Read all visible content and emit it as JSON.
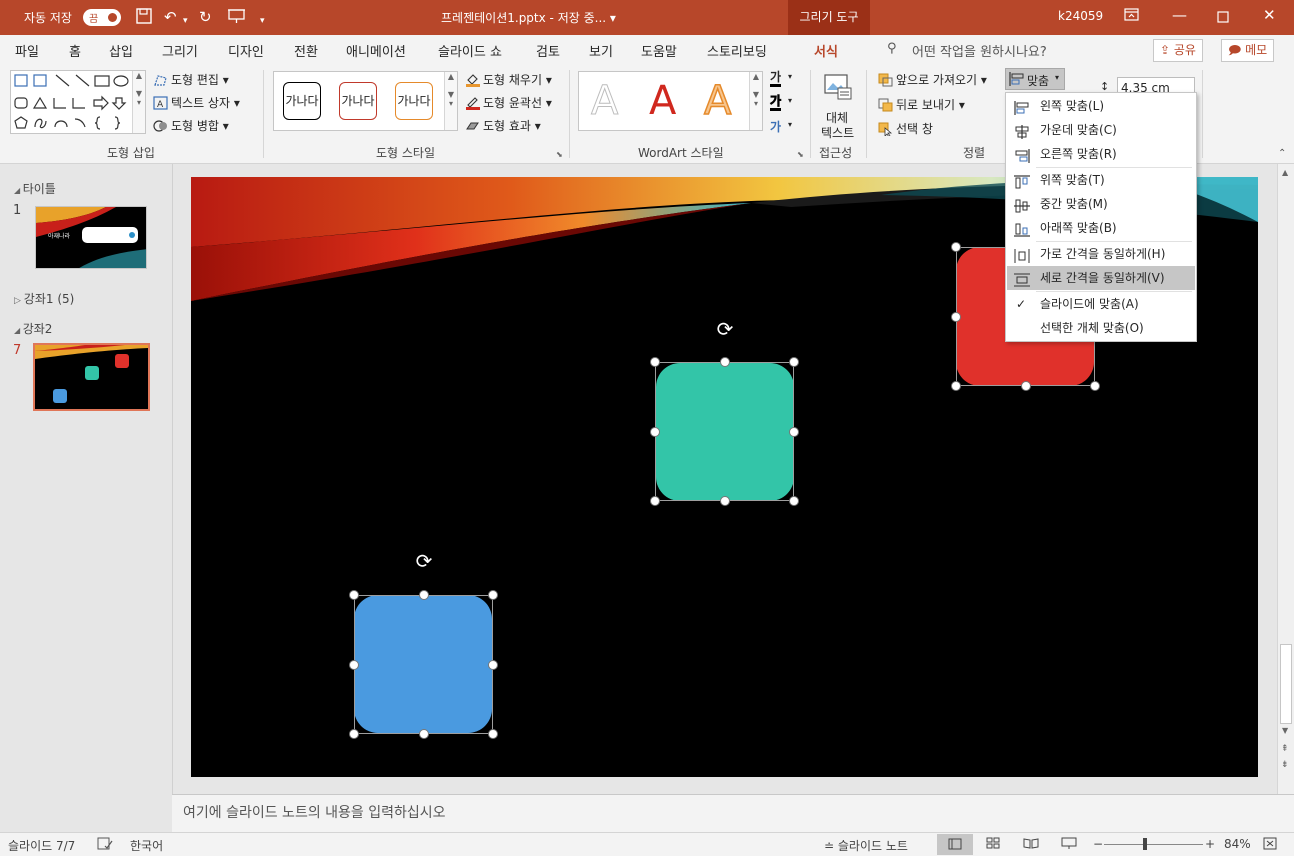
{
  "titlebar": {
    "autosave_label": "자동 저장",
    "autosave_state": "끔",
    "doc_title": "프레젠테이션1.pptx - 저장 중... ▾",
    "context_tab": "그리기 도구",
    "user": "k24059"
  },
  "tabs": [
    "파일",
    "홈",
    "삽입",
    "그리기",
    "디자인",
    "전환",
    "애니메이션",
    "슬라이드 쇼",
    "검토",
    "보기",
    "도움말",
    "스토리보딩",
    "서식"
  ],
  "tell_me": "어떤 작업을 원하시나요?",
  "share_label": "공유",
  "comments_label": "메모",
  "ribbon": {
    "insert_shapes": {
      "edit_shape": "도형 편집",
      "text_box": "텍스트 상자",
      "merge_shapes": "도형 병합",
      "label": "도형 삽입"
    },
    "shape_styles": {
      "preset_text": "가나다",
      "fill": "도형 채우기",
      "outline": "도형 윤곽선",
      "effects": "도형 효과",
      "label": "도형 스타일"
    },
    "wordart": {
      "glyph": "A",
      "text_glyph": "가",
      "label": "WordArt 스타일"
    },
    "accessibility": {
      "alt_text_1": "대체",
      "alt_text_2": "텍스트",
      "label": "접근성"
    },
    "arrange": {
      "bring_forward": "앞으로 가져오기",
      "send_backward": "뒤로 보내기",
      "selection_pane": "선택 창",
      "align": "맞춤",
      "label": "정렬"
    },
    "size": {
      "height": "4.35 cm"
    }
  },
  "align_menu": {
    "items": [
      "왼쪽 맞춤(L)",
      "가운데 맞춤(C)",
      "오른쪽 맞춤(R)",
      "위쪽 맞춤(T)",
      "중간 맞춤(M)",
      "아래쪽 맞춤(B)",
      "가로 간격을 동일하게(H)",
      "세로 간격을 동일하게(V)",
      "슬라이드에 맞춤(A)",
      "선택한 개체 맞춤(O)"
    ],
    "highlighted_index": 7,
    "checked_index": 8
  },
  "slide_pane": {
    "section_1": "타이틀",
    "slide_1_num": "1",
    "slide_1_text": "아재나라",
    "section_2": "강좌1 (5)",
    "section_3": "강좌2",
    "slide_7_num": "7"
  },
  "shapes": {
    "teal": "#33c5a8",
    "red": "#e0312b",
    "blue": "#4a9ae0"
  },
  "notes_placeholder": "여기에 슬라이드 노트의 내용을 입력하십시오",
  "status": {
    "slide_info": "슬라이드 7/7",
    "language": "한국어",
    "notes_toggle": "슬라이드 노트",
    "zoom": "84%"
  }
}
